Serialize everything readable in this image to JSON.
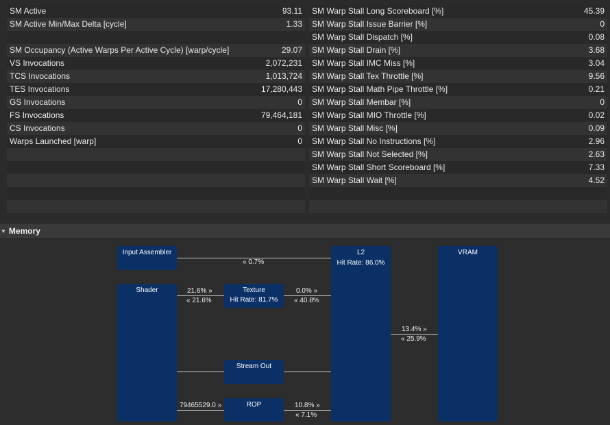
{
  "left_table": [
    {
      "label": "SM Active",
      "value": "93.11"
    },
    {
      "label": "SM Active Min/Max Delta [cycle]",
      "value": "1.33"
    },
    {
      "label": "",
      "value": ""
    },
    {
      "label": "SM Occupancy (Active Warps Per Active Cycle) [warp/cycle]",
      "value": "29.07"
    },
    {
      "label": "VS Invocations",
      "value": "2,072,231"
    },
    {
      "label": "TCS Invocations",
      "value": "1,013,724"
    },
    {
      "label": "TES Invocations",
      "value": "17,280,443"
    },
    {
      "label": "GS Invocations",
      "value": "0"
    },
    {
      "label": "FS Invocations",
      "value": "79,464,181"
    },
    {
      "label": "CS Invocations",
      "value": "0"
    },
    {
      "label": "Warps Launched [warp]",
      "value": "0"
    },
    {
      "label": "",
      "value": ""
    },
    {
      "label": "",
      "value": ""
    },
    {
      "label": "",
      "value": ""
    },
    {
      "label": "",
      "value": ""
    },
    {
      "label": "",
      "value": ""
    }
  ],
  "right_table": [
    {
      "label": "SM Warp Stall Long Scoreboard [%]",
      "value": "45.39"
    },
    {
      "label": "SM Warp Stall Issue Barrier [%]",
      "value": "0"
    },
    {
      "label": "SM Warp Stall Dispatch [%]",
      "value": "0.08"
    },
    {
      "label": "SM Warp Stall Drain [%]",
      "value": "3.68"
    },
    {
      "label": "SM Warp Stall IMC Miss [%]",
      "value": "3.04"
    },
    {
      "label": "SM Warp Stall Tex Throttle [%]",
      "value": "9.56"
    },
    {
      "label": "SM Warp Stall Math Pipe Throttle [%]",
      "value": "0.21"
    },
    {
      "label": "SM Warp Stall Membar [%]",
      "value": "0"
    },
    {
      "label": "SM Warp Stall MIO Throttle [%]",
      "value": "0.02"
    },
    {
      "label": "SM Warp Stall Misc [%]",
      "value": "0.09"
    },
    {
      "label": "SM Warp Stall No Instructions [%]",
      "value": "2.96"
    },
    {
      "label": "SM Warp Stall Not Selected [%]",
      "value": "2.63"
    },
    {
      "label": "SM Warp Stall Short Scoreboard [%]",
      "value": "7.33"
    },
    {
      "label": "SM Warp Stall Wait [%]",
      "value": "4.52"
    },
    {
      "label": "",
      "value": ""
    },
    {
      "label": "",
      "value": ""
    }
  ],
  "memory": {
    "section_title": "Memory",
    "boxes": {
      "input_assembler": "Input Assembler",
      "shader": "Shader",
      "texture": "Texture",
      "texture_hit": "Hit Rate: 81.7%",
      "stream_out": "Stream Out",
      "rop": "ROP",
      "l2": "L2",
      "l2_hit": "Hit Rate: 86.0%",
      "vram": "VRAM"
    },
    "labels": {
      "ia_l2_back": "« 0.7%",
      "shader_tex_fwd": "21.6% »",
      "shader_tex_back": "« 21.6%",
      "tex_l2_fwd": "0.0% »",
      "tex_l2_back": "« 40.8%",
      "l2_vram_fwd": "13.4% »",
      "l2_vram_back": "« 25.9%",
      "shader_rop_fwd": "79465529.0 »",
      "rop_l2_fwd": "10.8% »",
      "rop_l2_back": "« 7.1%"
    }
  },
  "colors": {
    "box": "#0a3066",
    "background": "#2d2d2d",
    "line": "#c9c9c9"
  }
}
